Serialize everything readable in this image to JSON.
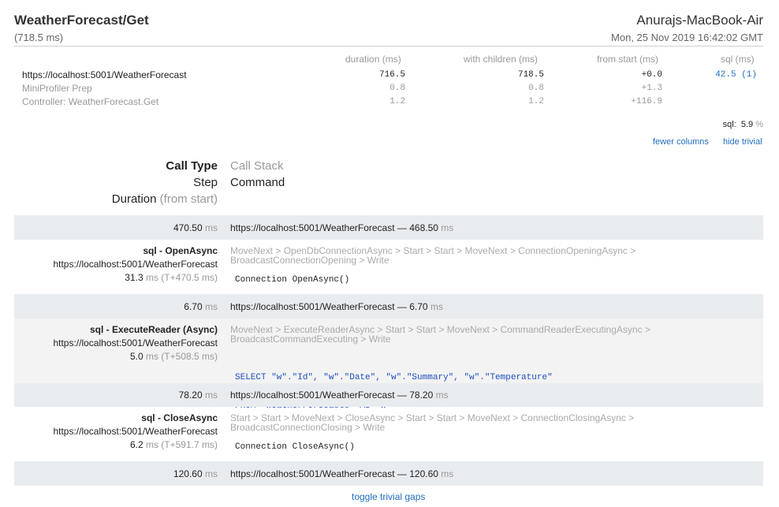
{
  "header": {
    "title": "WeatherForecast/Get",
    "duration": "(718.5 ms)",
    "machine": "Anurajs-MacBook-Air",
    "date": "Mon, 25 Nov 2019 16:42:02 GMT"
  },
  "table": {
    "columns": [
      "duration (ms)",
      "with children (ms)",
      "from start (ms)",
      "sql (ms)"
    ],
    "rows": [
      {
        "name": "https://localhost:5001/WeatherForecast",
        "duration": "716.5",
        "children": "718.5",
        "start": "+0.0",
        "sql": "42.5 (1)"
      },
      {
        "name": "MiniProfiler Prep",
        "duration": "0.8",
        "children": "0.8",
        "start": "+1.3",
        "sql": ""
      },
      {
        "name": "Controller: WeatherForecast.Get",
        "duration": "1.2",
        "children": "1.2",
        "start": "+116.9",
        "sql": ""
      }
    ],
    "sql_label": "sql:",
    "sql_value": "5.9",
    "sql_unit": "%",
    "fewer_columns": "fewer columns",
    "hide_trivial": "hide trivial"
  },
  "legend": {
    "call_type": "Call Type",
    "call_stack": "Call Stack",
    "step": "Step",
    "command": "Command",
    "duration": "Duration",
    "from_start": "(from start)"
  },
  "gaps": [
    {
      "value": "470.50",
      "unit": "ms",
      "url": "https://localhost:5001/WeatherForecast —",
      "right_value": "468.50",
      "right_unit": "ms"
    },
    {
      "value": "6.70",
      "unit": "ms",
      "url": "https://localhost:5001/WeatherForecast —",
      "right_value": "6.70",
      "right_unit": "ms"
    },
    {
      "value": "78.20",
      "unit": "ms",
      "url": "https://localhost:5001/WeatherForecast —",
      "right_value": "78.20",
      "right_unit": "ms"
    },
    {
      "value": "120.60",
      "unit": "ms",
      "url": "https://localhost:5001/WeatherForecast —",
      "right_value": "120.60",
      "right_unit": "ms"
    }
  ],
  "calls": [
    {
      "type": "sql - OpenAsync",
      "url": "https://localhost:5001/WeatherForecast",
      "dur": "31.3",
      "dur_rest": "ms (T+470.5 ms)",
      "stack_1": "MoveNext > OpenDbConnectionAsync > Start > Start > MoveNext > ConnectionOpeningAsync >",
      "stack_2": "BroadcastConnectionOpening > Write",
      "cmd": "Connection OpenAsync()"
    },
    {
      "type": "sql - ExecuteReader (Async)",
      "url": "https://localhost:5001/WeatherForecast",
      "dur": "5.0",
      "dur_rest": "ms (T+508.5 ms)",
      "stack_1": "MoveNext > ExecuteReaderAsync > Start > Start > MoveNext > CommandReaderExecutingAsync >",
      "stack_2": "BroadcastCommandExecuting > Write",
      "cmd_1": "SELECT \"w\".\"Id\", \"w\".\"Date\", \"w\".\"Summary\", \"w\".\"Temperature\"",
      "cmd_2": "FROM \"WeatherForecasts\" AS \"w\""
    },
    {
      "type": "sql - CloseAsync",
      "url": "https://localhost:5001/WeatherForecast",
      "dur": "6.2",
      "dur_rest": "ms (T+591.7 ms)",
      "stack_1": "Start > Start > MoveNext > CloseAsync > Start > Start > MoveNext > ConnectionClosingAsync >",
      "stack_2": "BroadcastConnectionClosing > Write",
      "cmd": "Connection CloseAsync()"
    }
  ],
  "footer": {
    "toggle": "toggle trivial gaps"
  }
}
